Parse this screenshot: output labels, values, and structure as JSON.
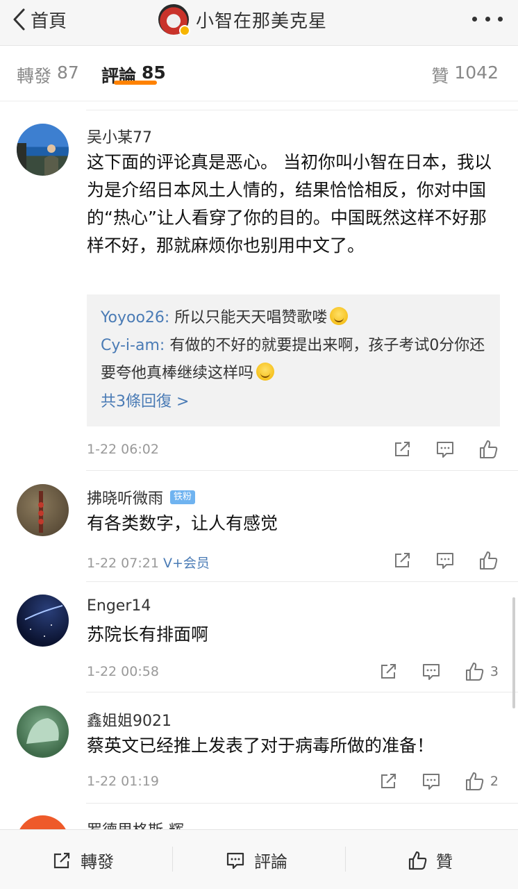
{
  "nav": {
    "back_label": "首頁",
    "title": "小智在那美克星"
  },
  "tabs": {
    "forward_label": "轉發",
    "forward_count": "87",
    "comment_label": "評論",
    "comment_count": "85",
    "likes_label": "贊",
    "likes_count": "1042"
  },
  "comments": [
    {
      "name": "吴小某77",
      "text": "这下面的评论真是恶心。 当初你叫小智在日本，我以为是介绍日本风土人情的，结果恰恰相反，你对中国的“热心”让人看穿了你的目的。中国既然这样不好那样不好，那就麻烦你也别用中文了。",
      "time": "1-22 06:02",
      "replies": [
        {
          "name": "Yoyoo26:",
          "text": "所以只能天天唱赞歌喽"
        },
        {
          "name": "Cy-i-am:",
          "text": "有做的不好的就要提出来啊，孩子考试0分你还要夸他真棒继续这样吗"
        }
      ],
      "reply_more": "共3條回復 >"
    },
    {
      "name": "拂晓听微雨",
      "badge": "铁粉",
      "text": "有各类数字，让人有感觉",
      "time": "1-22 07:21",
      "vip": "V+会员"
    },
    {
      "name": "Enger14",
      "text": "苏院长有排面啊",
      "time": "1-22 00:58",
      "likes": "3"
    },
    {
      "name": "鑫姐姐9021",
      "text": "蔡英文已经推上发表了对于病毒所做的准备！",
      "time": "1-22 01:19",
      "likes": "2"
    },
    {
      "name": "罗德里格斯-辉"
    }
  ],
  "bottom": {
    "repost_label": "轉發",
    "comment_label": "評論",
    "like_label": "贊"
  },
  "colors": {
    "accent": "#ff8200",
    "link": "#4a7bb5",
    "muted": "#999999"
  }
}
